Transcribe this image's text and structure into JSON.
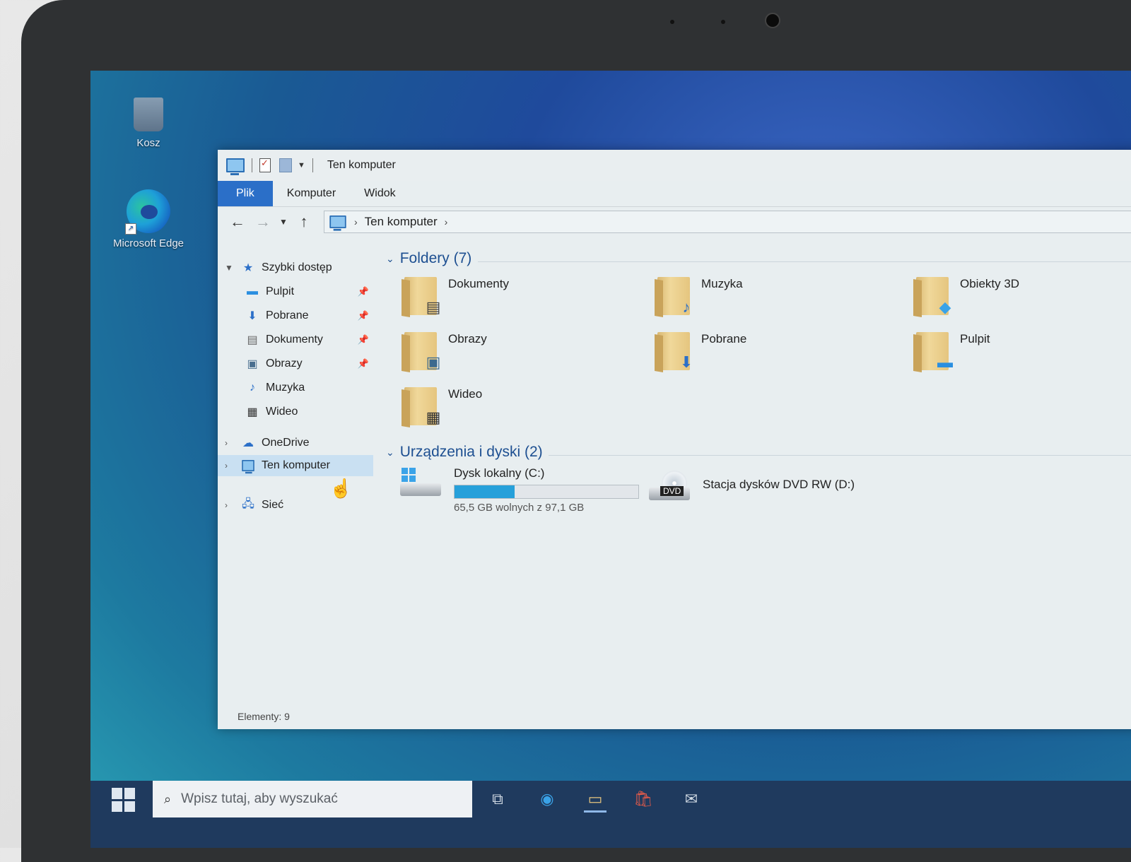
{
  "desktop": {
    "icons": [
      {
        "label": "Kosz",
        "icon": "recycle-bin-icon"
      },
      {
        "label": "Microsoft Edge",
        "icon": "edge-icon"
      }
    ]
  },
  "window": {
    "title": "Ten komputer",
    "ribbon_tabs": [
      "Plik",
      "Komputer",
      "Widok"
    ],
    "address": {
      "segments": [
        "Ten komputer"
      ]
    },
    "nav_pane": {
      "quick_access": "Szybki dostęp",
      "quick_items": [
        "Pulpit",
        "Pobrane",
        "Dokumenty",
        "Obrazy",
        "Muzyka",
        "Wideo"
      ],
      "onedrive": "OneDrive",
      "this_pc": "Ten komputer",
      "network": "Sieć"
    },
    "folders_group": {
      "title": "Foldery (7)",
      "items": [
        "Dokumenty",
        "Muzyka",
        "Obiekty 3D",
        "Obrazy",
        "Pobrane",
        "Pulpit",
        "Wideo"
      ]
    },
    "devices_group": {
      "title": "Urządzenia i dyski (2)",
      "drive_c": {
        "name": "Dysk lokalny (C:)",
        "free_text": "65,5 GB wolnych z 97,1 GB",
        "used_fraction": 0.325
      },
      "drive_d": {
        "name": "Stacja dysków DVD RW (D:)",
        "badge": "DVD"
      }
    },
    "status": "Elementy: 9"
  },
  "taskbar": {
    "search_placeholder": "Wpisz tutaj, aby wyszukać"
  },
  "colors": {
    "accent": "#2b6fc8",
    "selection": "#c9e0f2",
    "bar_fill": "#26a0da"
  }
}
